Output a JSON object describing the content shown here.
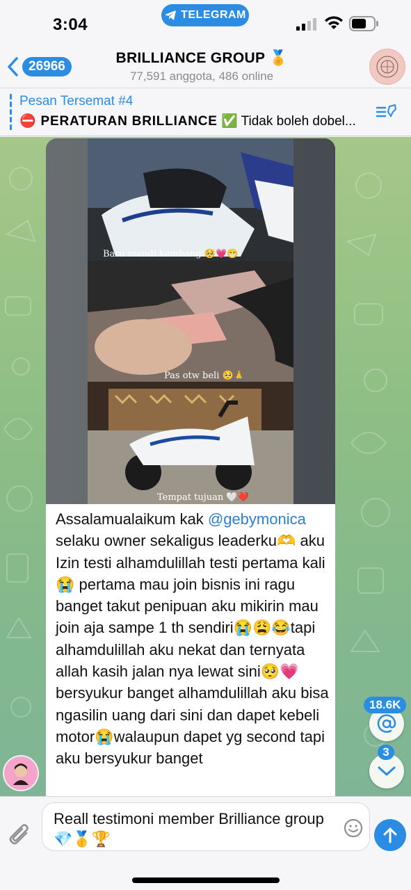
{
  "status_bar": {
    "time": "3:04",
    "app_pill": "TELEGRAM",
    "icons": [
      "signal-icon",
      "wifi-icon",
      "battery-icon"
    ]
  },
  "header": {
    "back_count": "26966",
    "title": "BRILLIANCE GROUP 🏅",
    "subtitle": "77,591 anggota, 486 online"
  },
  "pinned": {
    "title": "Pesan Tersemat #4",
    "text_bold": "⛔ PERATURAN BRILLIANCE",
    "text_rest": " ✅ Tidak boleh dobel..."
  },
  "message": {
    "photo_captions": [
      "Baru mandi kembang 🥺💗😁",
      "Pas otw beli 🥺🙏",
      "Tempat tujuan 🤍❤️"
    ],
    "text_before": "Assalamualaikum kak ",
    "mention": "@gebymonica",
    "text_after": " selaku owner sekaligus leaderku🫶 aku Izin testi alhamdulillah testi pertama kali 😭 pertama mau join bisnis ini ragu banget takut penipuan aku mikirin mau join aja sampe 1 th sendiri😭😩😂tapi alhamdulillah aku nekat dan ternyata allah kasih jalan nya lewat sini🥺💗bersyukur banget alhamdulillah aku bisa ngasilin uang dari sini dan dapet kebeli motor😭walaupun dapet yg second tapi aku bersyukur banget"
  },
  "floating": {
    "mention_count": "18.6K",
    "unread_count": "3"
  },
  "input": {
    "value": "Reall testimoni member Brilliance group💎🥇🏆"
  },
  "colors": {
    "accent": "#2a8de3",
    "chat_bg": "#8fbf84"
  }
}
